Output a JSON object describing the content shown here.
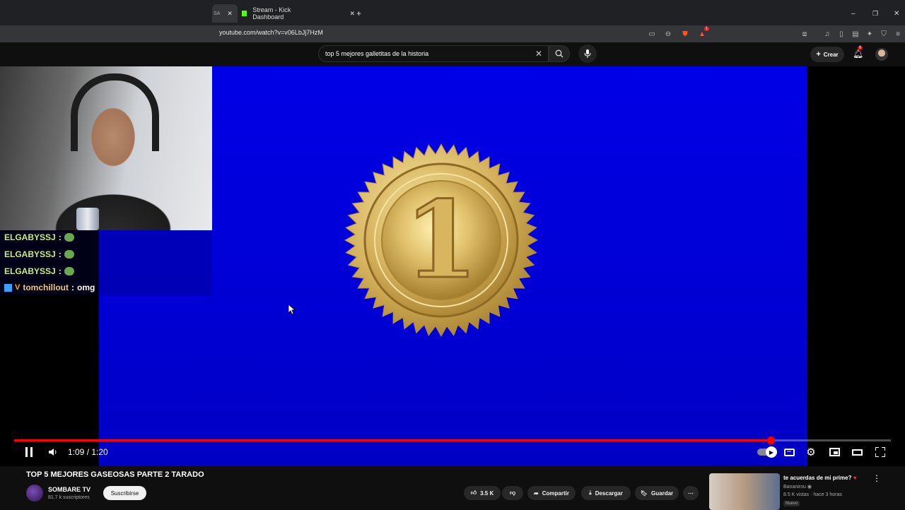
{
  "browser": {
    "tabs": [
      {
        "label": "SA",
        "active": true
      },
      {
        "label": "Stream - Kick Dashboard",
        "active": false
      }
    ],
    "url": "youtube.com/watch?v=v06LbJj7HzM",
    "notification_badge": "1"
  },
  "youtube": {
    "search_query": "top 5 mejores galletitas de la historia",
    "create_label": "Crear",
    "notifications_count": "6"
  },
  "webcam_chat": [
    {
      "user": "ELGABYSSJ",
      "message": ""
    },
    {
      "user": "ELGABYSSJ",
      "message": ""
    },
    {
      "user": "ELGABYSSJ",
      "message": ""
    },
    {
      "user": "tomchillout",
      "message": "omg"
    }
  ],
  "player": {
    "time_current": "1:09",
    "time_total": "1:20",
    "progress": 0.8629,
    "medal_number": "1",
    "colors": {
      "screen": "#0000e0",
      "progress": "#ff0000"
    }
  },
  "video": {
    "title": "TOP 5 MEJORES GASEOSAS PARTE 2 TARADO",
    "channel": "SOMBARE TV",
    "subscribers": "81.7 k suscriptores",
    "subscribe_label": "Suscribirse",
    "likes": "3.5 K",
    "share_label": "Compartir",
    "download_label": "Descargar",
    "save_label": "Guardar"
  },
  "recommended": {
    "title": "te acuerdas de mi prime?",
    "channel": "Bananirou",
    "meta": "8.5 K vistas · hace 3 horas",
    "badge": "Nuevo"
  }
}
